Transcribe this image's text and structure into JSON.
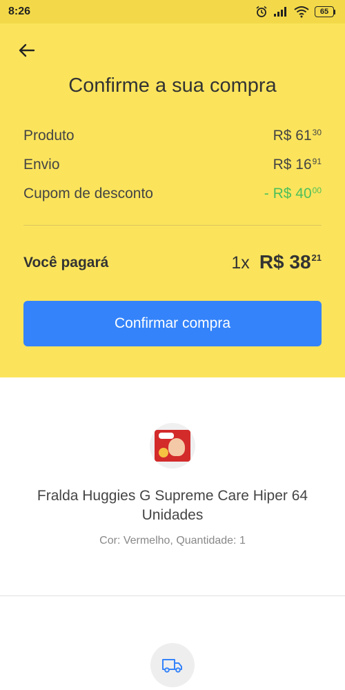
{
  "status_bar": {
    "time": "8:26",
    "battery": "65",
    "icons": [
      "alarm-icon",
      "signal-icon",
      "wifi-icon",
      "battery-icon"
    ]
  },
  "header": {
    "back_icon": "arrow-left-icon",
    "title": "Confirme a sua compra",
    "background_color": "#fbe45c"
  },
  "summary": {
    "rows": [
      {
        "label": "Produto",
        "value_main": "R$ 61",
        "value_cents": "30"
      },
      {
        "label": "Envio",
        "value_main": "R$ 16",
        "value_cents": "91"
      },
      {
        "label": "Cupom de desconto",
        "value_main": "- R$ 40",
        "value_cents": "00",
        "color": "#4fbf5a"
      }
    ],
    "total_label": "Você pagará",
    "total_qty": "1x",
    "total_main": "R$ 38",
    "total_cents": "21"
  },
  "confirm_button": {
    "label": "Confirmar compra",
    "color": "#3483fa"
  },
  "product": {
    "name": "Fralda Huggies G Supreme Care Hiper 64 Unidades",
    "meta": "Cor: Vermelho, Quantidade: 1"
  },
  "shipping": {
    "icon": "truck-icon"
  }
}
